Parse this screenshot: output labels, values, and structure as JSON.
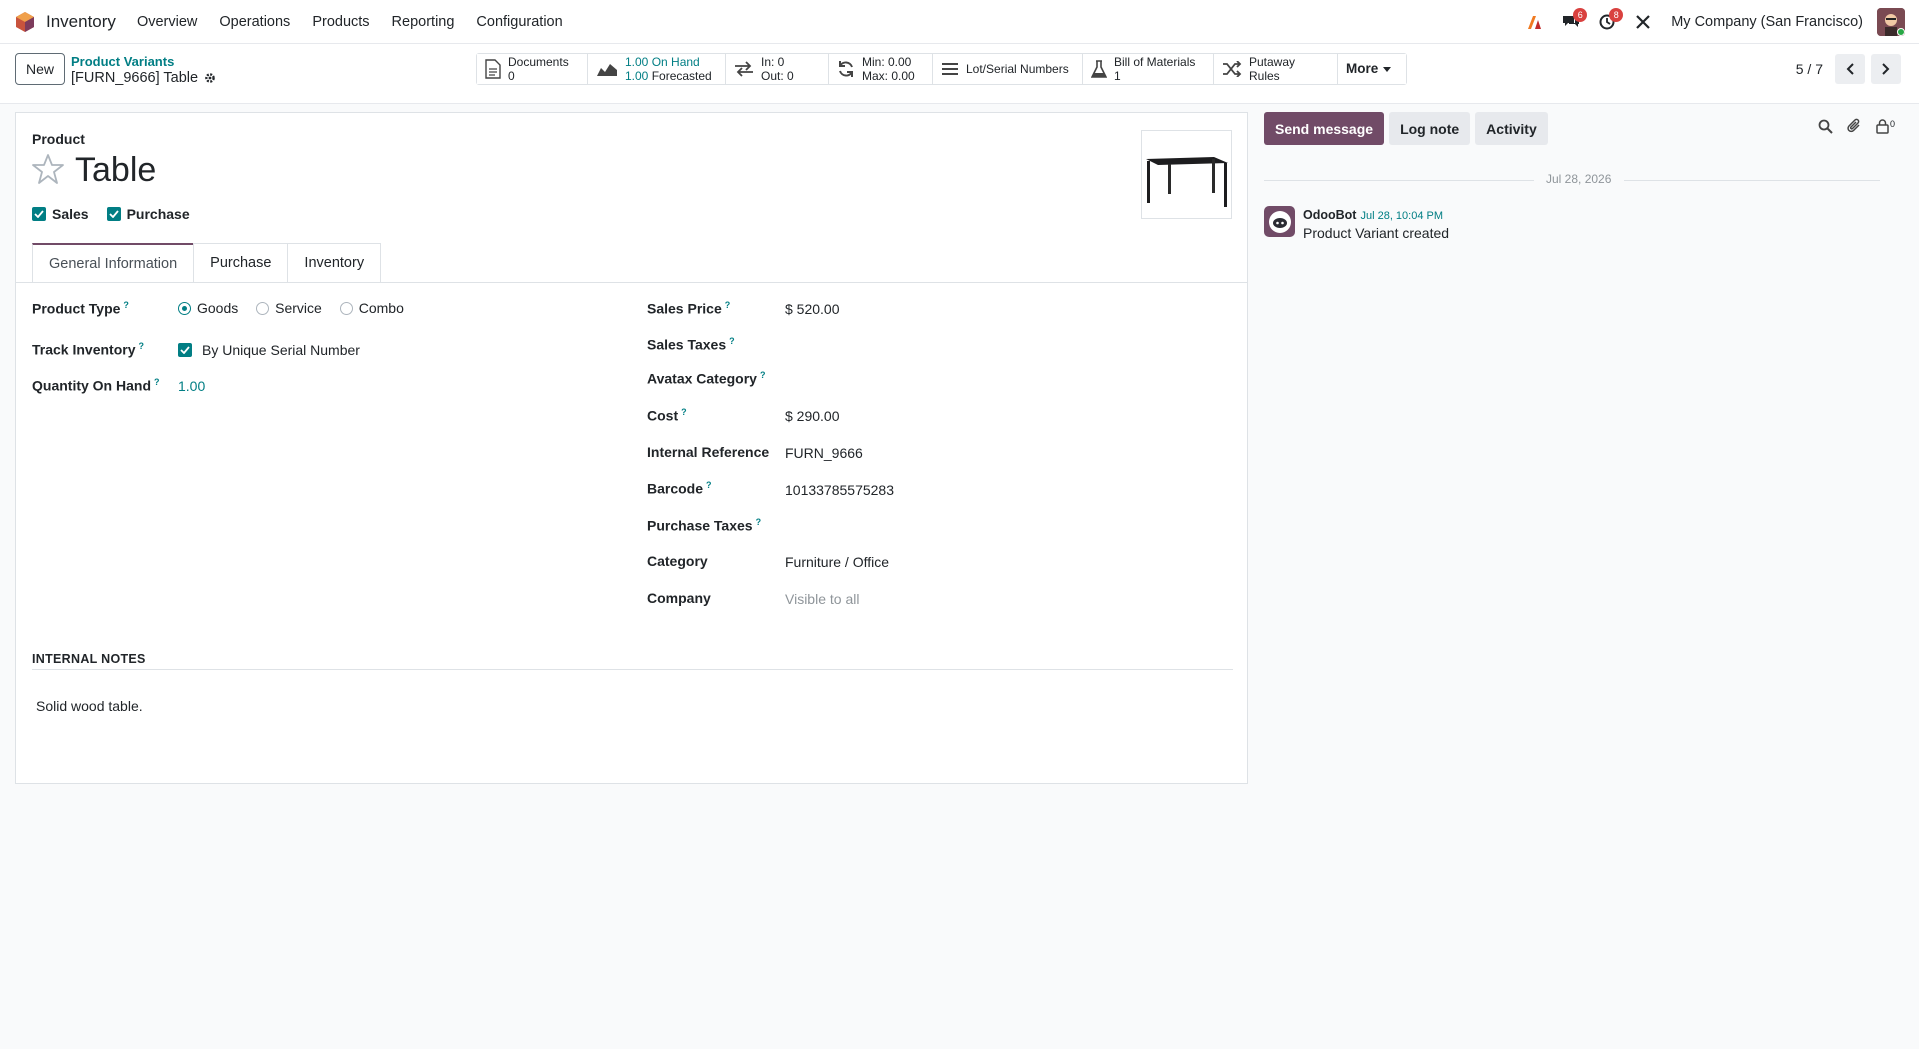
{
  "navbar": {
    "app_name": "Inventory",
    "menu": [
      "Overview",
      "Operations",
      "Products",
      "Reporting",
      "Configuration"
    ],
    "messages_count": "6",
    "activities_count": "8",
    "company": "My Company (San Francisco)"
  },
  "control": {
    "new_label": "New",
    "breadcrumb_parent": "Product Variants",
    "breadcrumb_current": "[FURN_9666] Table",
    "smart_buttons": {
      "documents_label": "Documents",
      "documents_value": "0",
      "on_hand": "1.00 On Hand",
      "forecasted_value": "1.00",
      "forecasted_label": "Forecasted",
      "in": "In: 0",
      "out": "Out: 0",
      "min": "Min: 0.00",
      "max": "Max: 0.00",
      "lots": "Lot/Serial Numbers",
      "bom_label": "Bill of Materials",
      "bom_value": "1",
      "putaway": "Putaway Rules",
      "more": "More"
    },
    "pager": "5 / 7"
  },
  "form": {
    "product_label": "Product",
    "title": "Table",
    "sales_label": "Sales",
    "purchase_label": "Purchase",
    "tabs": [
      "General Information",
      "Purchase",
      "Inventory"
    ],
    "left": {
      "product_type_label": "Product Type",
      "product_type_options": [
        "Goods",
        "Service",
        "Combo"
      ],
      "track_inventory_label": "Track Inventory",
      "track_inventory_value": "By Unique Serial Number",
      "qty_label": "Quantity On Hand",
      "qty_value": "1.00"
    },
    "right": {
      "sales_price_label": "Sales Price",
      "sales_price": "$ 520.00",
      "sales_taxes_label": "Sales Taxes",
      "avatax_label": "Avatax Category",
      "cost_label": "Cost",
      "cost": "$ 290.00",
      "internal_ref_label": "Internal Reference",
      "internal_ref": "FURN_9666",
      "barcode_label": "Barcode",
      "barcode": "10133785575283",
      "purchase_taxes_label": "Purchase Taxes",
      "category_label": "Category",
      "category": "Furniture / Office",
      "company_label": "Company",
      "company_placeholder": "Visible to all"
    },
    "notes_header": "INTERNAL NOTES",
    "notes": "Solid wood table."
  },
  "chatter": {
    "send_message": "Send message",
    "log_note": "Log note",
    "activity": "Activity",
    "followers": "0",
    "date": "Jul 28, 2026",
    "author": "OdooBot",
    "time": "Jul 28, 10:04 PM",
    "body": "Product Variant created"
  },
  "colors": {
    "brand": "#714b67",
    "accent": "#017e84"
  }
}
